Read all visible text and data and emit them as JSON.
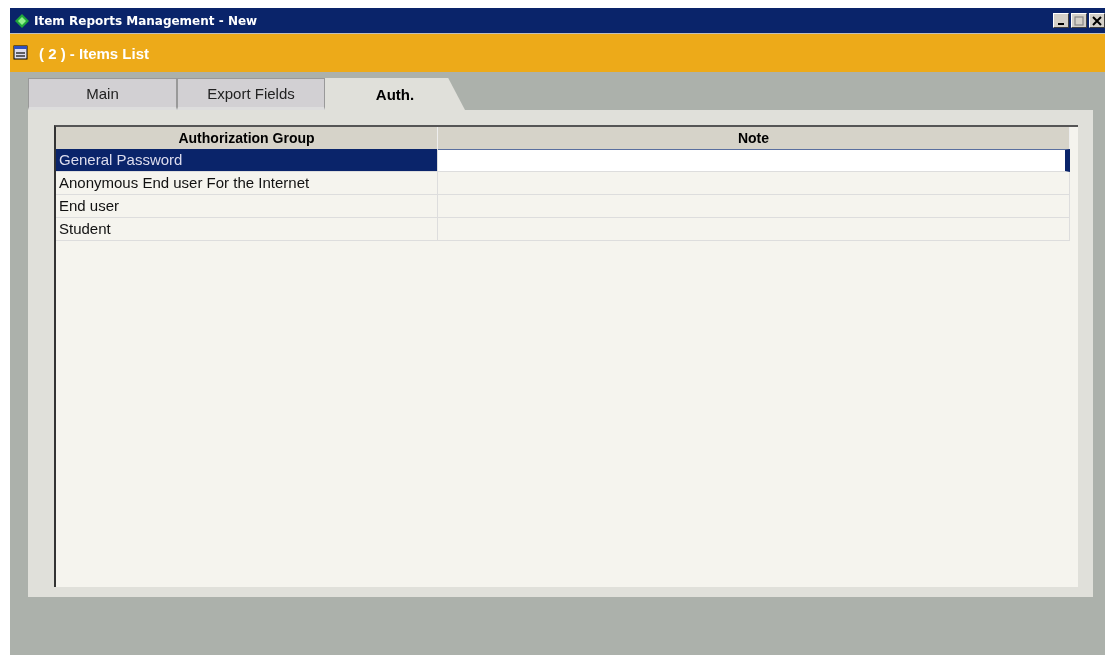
{
  "window": {
    "title": "Item Reports Management - New"
  },
  "header": {
    "title": "( 2 ) - Items List"
  },
  "tabs": [
    {
      "label": "Main",
      "selected": false
    },
    {
      "label": "Export Fields",
      "selected": false
    },
    {
      "label": "Auth.",
      "selected": true
    }
  ],
  "table": {
    "columns": [
      "Authorization Group",
      "Note"
    ],
    "rows": [
      {
        "group": "General Password",
        "selected": true
      },
      {
        "group": "Anonymous End user For the Internet",
        "selected": false
      },
      {
        "group": "End user",
        "selected": false
      },
      {
        "group": "Student",
        "selected": false
      }
    ]
  }
}
